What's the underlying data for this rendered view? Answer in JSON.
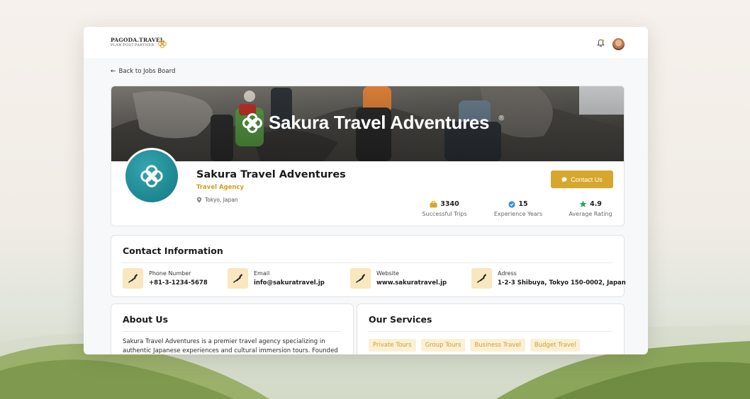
{
  "brand": {
    "title": "PAGODA.TRAVEL",
    "subtitle": "PLAN.POST.PARTNER"
  },
  "icons": {
    "notifications": "bell-icon",
    "back": "arrow-left-icon",
    "location": "map-pin-icon",
    "chat": "chat-bubble-icon",
    "trips": "luggage-icon",
    "experience": "verified-badge-icon",
    "rating": "star-icon",
    "contact_item": "japan-map-icon"
  },
  "colors": {
    "accent": "#d6a72c",
    "accent_text": "#cf9f1c",
    "tag_bg": "#fbf0d6",
    "teal": "#1d8690",
    "verified": "#3b8fd9",
    "star": "#2fa35a"
  },
  "nav": {
    "back_label": "Back to Jobs Board"
  },
  "banner": {
    "title": "Sakura Travel Adventures",
    "registered_mark": "®"
  },
  "profile": {
    "name": "Sakura Travel Adventures",
    "type": "Travel Agency",
    "location": "Tokyo, Japan",
    "contact_button": "Contact Us",
    "stats": [
      {
        "value": "3340",
        "label": "Successful Trips"
      },
      {
        "value": "15",
        "label": "Experience Years"
      },
      {
        "value": "4.9",
        "label": "Average Rating"
      }
    ]
  },
  "contact": {
    "title": "Contact Information",
    "items": [
      {
        "label": "Phone Number",
        "value": "+81-3-1234-5678"
      },
      {
        "label": "Email",
        "value": "info@sakuratravel.jp"
      },
      {
        "label": "Website",
        "value": "www.sakuratravel.jp"
      },
      {
        "label": "Adress",
        "value": "1-2-3 Shibuya, Tokyo 150-0002, Japan"
      }
    ]
  },
  "about": {
    "title": "About Us",
    "text": "Sakura Travel Adventures is a premier travel agency specializing in authentic Japanese experiences and cultural immersion tours. Founded in"
  },
  "services": {
    "title": "Our Services",
    "tags": [
      "Private Tours",
      "Group Tours",
      "Business Travel",
      "Budget Travel"
    ]
  }
}
